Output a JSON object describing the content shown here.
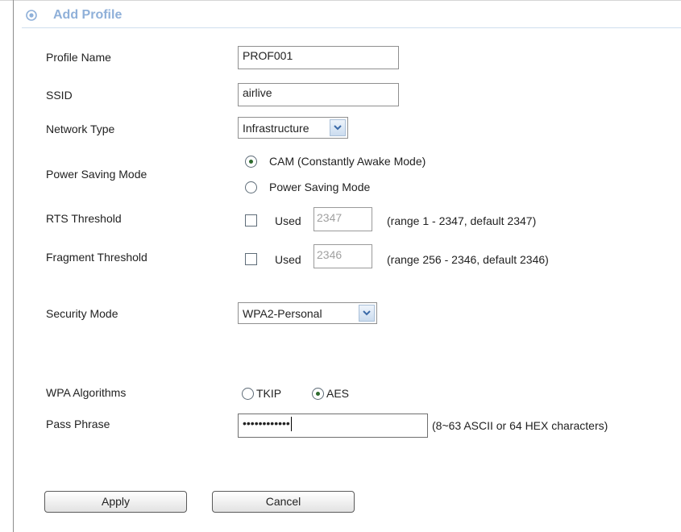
{
  "header": {
    "title": "Add Profile",
    "icon": "target-icon"
  },
  "fields": {
    "profile_name": {
      "label": "Profile Name",
      "value": "PROF001"
    },
    "ssid": {
      "label": "SSID",
      "value": "airlive"
    },
    "network_type": {
      "label": "Network Type",
      "selected": "Infrastructure"
    },
    "power_saving": {
      "label": "Power Saving Mode",
      "options": [
        {
          "label": "CAM (Constantly Awake Mode)",
          "selected": true
        },
        {
          "label": "Power Saving Mode",
          "selected": false
        }
      ]
    },
    "rts": {
      "label": "RTS Threshold",
      "checkbox_label": "Used",
      "checked": false,
      "value": "2347",
      "hint": "(range 1 - 2347, default 2347)"
    },
    "fragment": {
      "label": "Fragment Threshold",
      "checkbox_label": "Used",
      "checked": false,
      "value": "2346",
      "hint": "(range 256 - 2346, default 2346)"
    },
    "security_mode": {
      "label": "Security Mode",
      "selected": "WPA2-Personal"
    },
    "wpa_algorithms": {
      "label": "WPA Algorithms",
      "options": [
        {
          "label": "TKIP",
          "selected": false
        },
        {
          "label": "AES",
          "selected": true
        }
      ]
    },
    "pass_phrase": {
      "label": "Pass Phrase",
      "value": "••••••••••••",
      "hint": "(8~63 ASCII or 64 HEX characters)"
    }
  },
  "buttons": {
    "apply": "Apply",
    "cancel": "Cancel"
  }
}
